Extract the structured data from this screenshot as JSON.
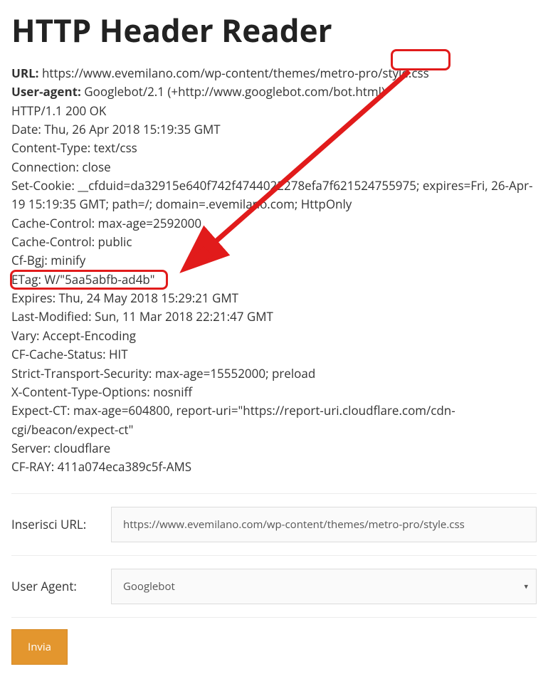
{
  "title": "HTTP Header Reader",
  "header_labels": {
    "url": "URL:",
    "user_agent": "User-agent:"
  },
  "header_values": {
    "url": "https://www.evemilano.com/wp-content/themes/metro-pro/style.css",
    "user_agent": "Googlebot/2.1 (+http://www.googlebot.com/bot.html)"
  },
  "response_lines": [
    "HTTP/1.1 200 OK",
    "Date: Thu, 26 Apr 2018 15:19:35 GMT",
    "Content-Type: text/css",
    "Connection: close",
    "Set-Cookie: __cfduid=da32915e640f742f4744022278efa7f621524755975; expires=Fri, 26-Apr-19 15:19:35 GMT; path=/; domain=.evemilano.com; HttpOnly",
    "Cache-Control: max-age=2592000",
    "Cache-Control: public",
    "Cf-Bgj: minify",
    "ETag: W/\"5aa5abfb-ad4b\"",
    "Expires: Thu, 24 May 2018 15:29:21 GMT",
    "Last-Modified: Sun, 11 Mar 2018 22:21:47 GMT",
    "Vary: Accept-Encoding",
    "CF-Cache-Status: HIT",
    "Strict-Transport-Security: max-age=15552000; preload",
    "X-Content-Type-Options: nosniff",
    "Expect-CT: max-age=604800, report-uri=\"https://report-uri.cloudflare.com/cdn-cgi/beacon/expect-ct\"",
    "Server: cloudflare",
    "CF-RAY: 411a074eca389c5f-AMS"
  ],
  "form": {
    "url_label": "Inserisci URL:",
    "url_value": "https://www.evemilano.com/wp-content/themes/metro-pro/style.css",
    "ua_label": "User Agent:",
    "ua_selected": "Googlebot",
    "submit": "Invia"
  },
  "annotations": {
    "box_url_segment": "style.css (path segment highlighted)",
    "box_etag": "ETag header highlighted",
    "arrow": "Arrow from URL segment to ETag header"
  },
  "colors": {
    "annotation_red": "#e11b1b",
    "button_bg": "#e3962e"
  }
}
